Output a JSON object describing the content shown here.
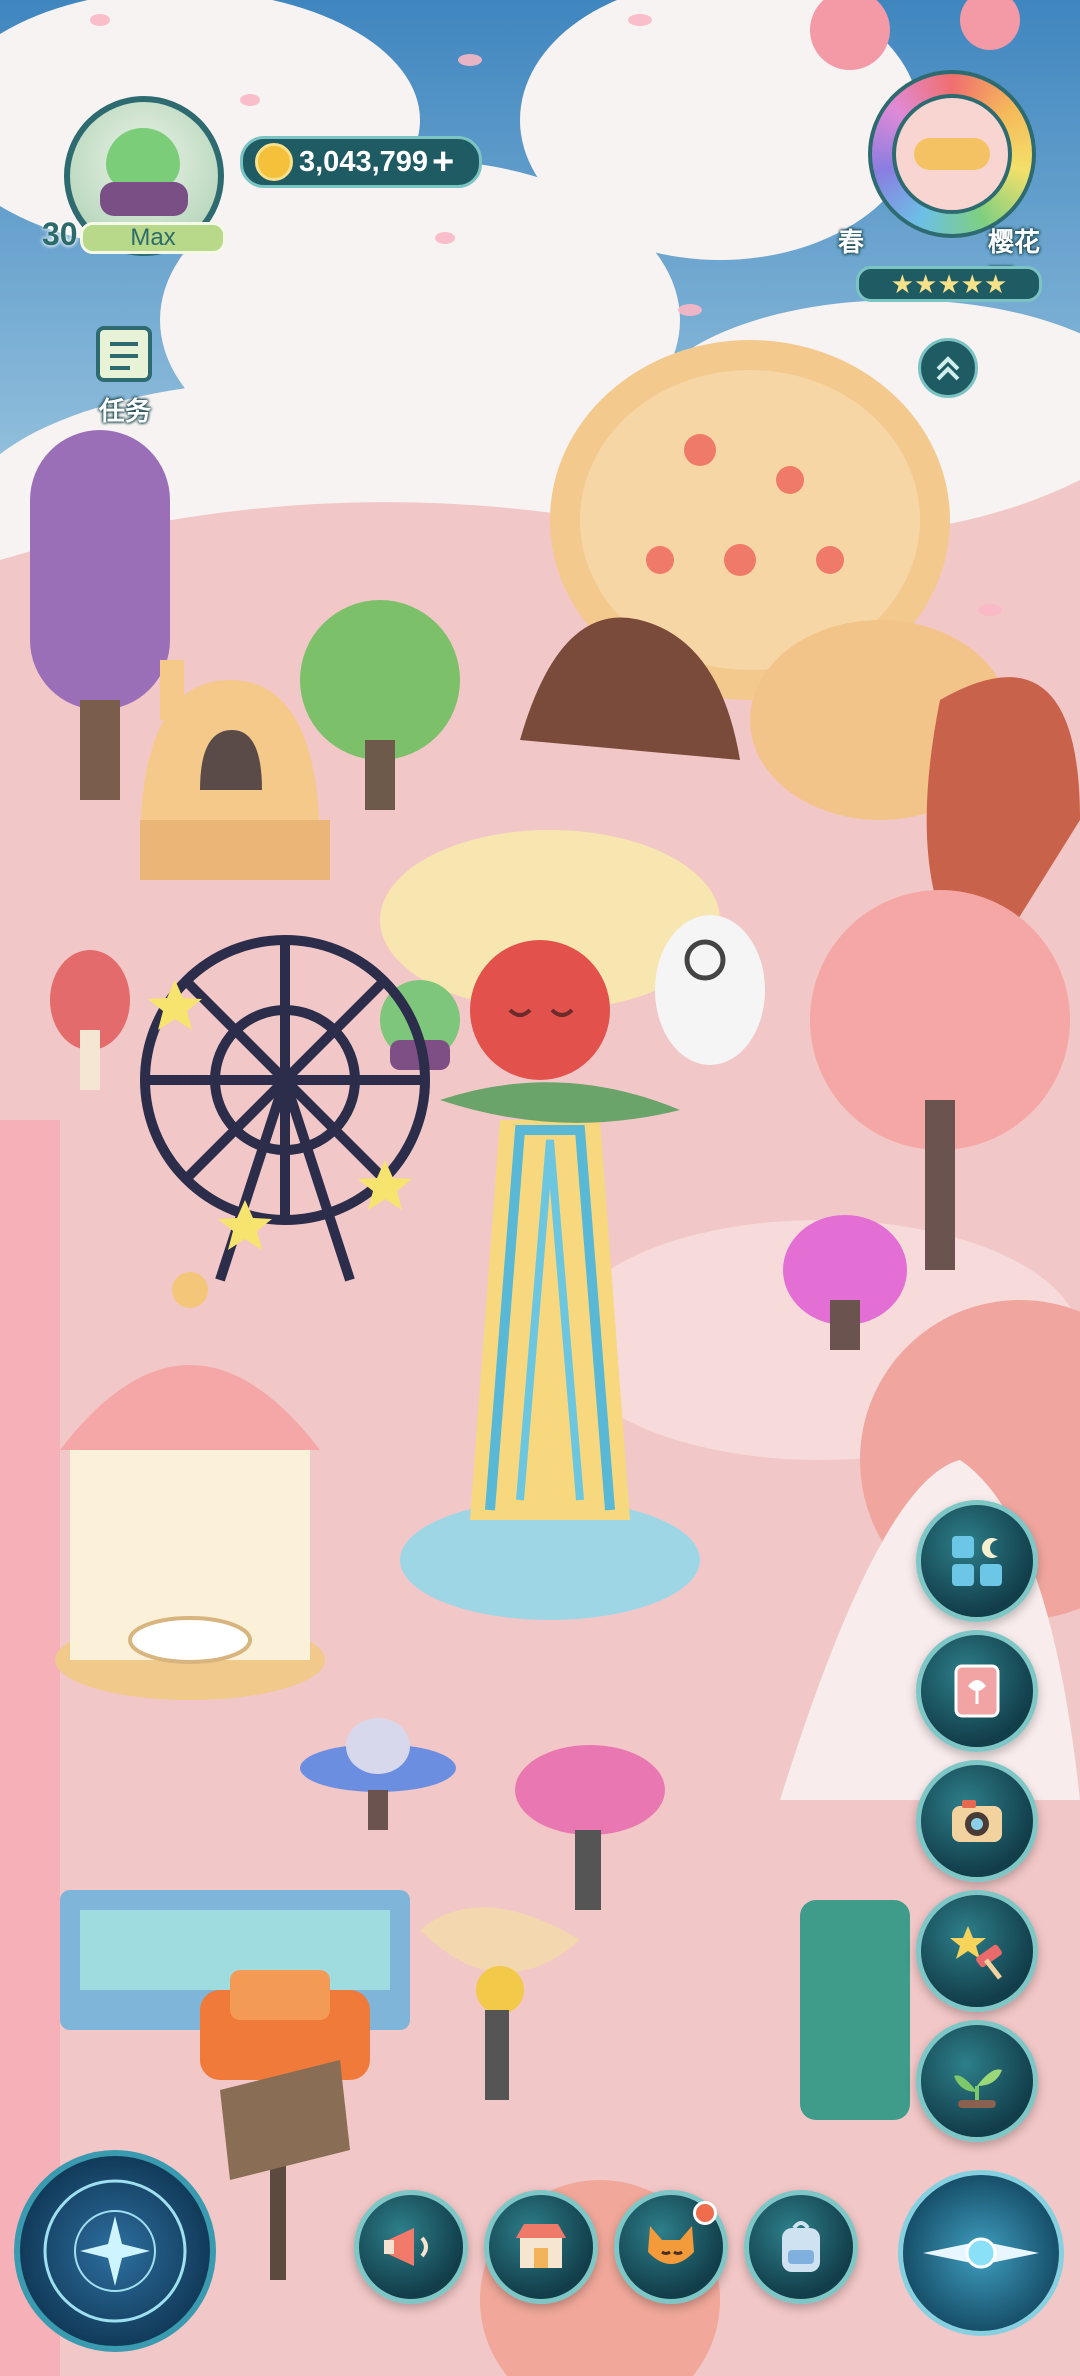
{
  "player": {
    "level": "30",
    "level_label": "Max",
    "avatar_icon": "frog-avatar-icon"
  },
  "currency": {
    "amount": "3,043,799",
    "icon": "gold-coin-icon",
    "add": "+"
  },
  "quest": {
    "label": "任务",
    "icon": "quest-scroll-icon"
  },
  "season": {
    "season": "春",
    "weather": "樱花雨",
    "stars": "★★★★★",
    "icon": "cloud-weather-icon"
  },
  "expand": {
    "icon": "chevron-up-double-icon"
  },
  "side_menu": [
    {
      "name": "theme-menu-button",
      "icon": "grid-moon-icon"
    },
    {
      "name": "guide-book-button",
      "icon": "tulip-book-icon"
    },
    {
      "name": "camera-button",
      "icon": "camera-icon"
    },
    {
      "name": "event-button",
      "icon": "star-hammer-icon"
    },
    {
      "name": "garden-button",
      "icon": "sprout-icon"
    }
  ],
  "bottom_bar": [
    {
      "name": "megaphone-button",
      "icon": "megaphone-icon"
    },
    {
      "name": "shop-button",
      "icon": "shop-icon"
    },
    {
      "name": "fox-friend-button",
      "icon": "fox-icon",
      "badge": true
    },
    {
      "name": "backpack-button",
      "icon": "backpack-icon"
    }
  ],
  "colors": {
    "accent": "#1f5b63",
    "border": "#7cc4c4",
    "ground": "#f2c7c7",
    "sky": "#4d94c6"
  }
}
